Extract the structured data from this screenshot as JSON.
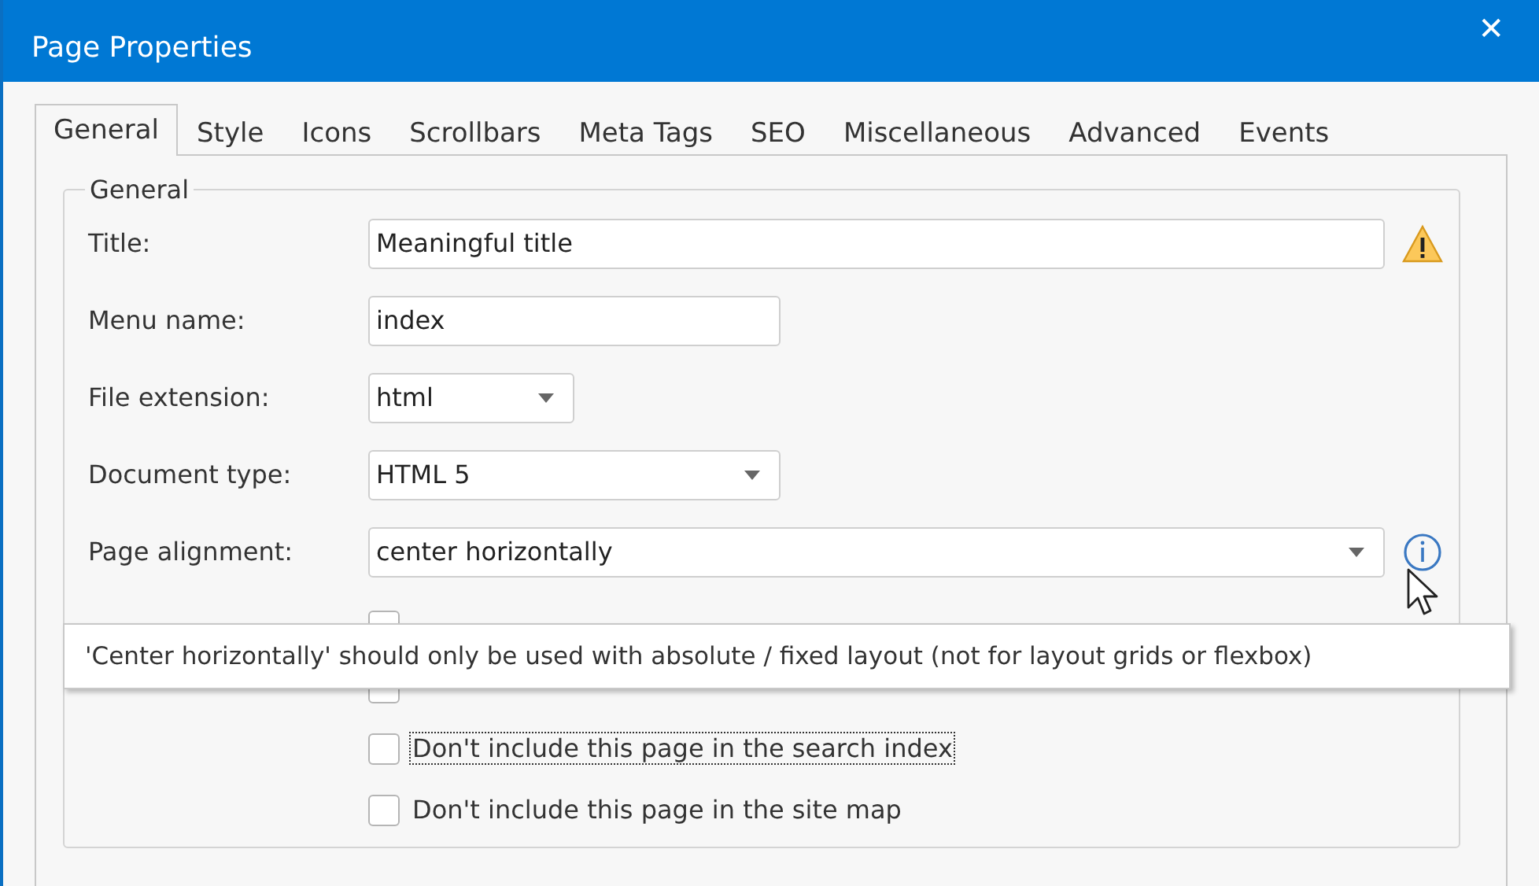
{
  "window": {
    "title": "Page Properties",
    "close": "✕"
  },
  "tabs": [
    {
      "label": "General",
      "selected": true
    },
    {
      "label": "Style",
      "selected": false
    },
    {
      "label": "Icons",
      "selected": false
    },
    {
      "label": "Scrollbars",
      "selected": false
    },
    {
      "label": "Meta Tags",
      "selected": false
    },
    {
      "label": "SEO",
      "selected": false
    },
    {
      "label": "Miscellaneous",
      "selected": false
    },
    {
      "label": "Advanced",
      "selected": false
    },
    {
      "label": "Events",
      "selected": false
    }
  ],
  "group": {
    "legend": "General"
  },
  "fields": [
    {
      "kind": "text",
      "label": "Title:",
      "value": "Meaningful title"
    },
    {
      "kind": "text",
      "label": "Menu name:",
      "value": "index"
    },
    {
      "kind": "select",
      "label": "File extension:",
      "value": "html"
    },
    {
      "kind": "select",
      "label": "Document type:",
      "value": "HTML 5"
    },
    {
      "kind": "select",
      "label": "Page alignment:",
      "value": "center horizontally"
    }
  ],
  "checkboxes": [
    {
      "checked": false
    },
    {
      "checked": false
    },
    {
      "label": "Don't include this page in the search index",
      "checked": false,
      "focused": true
    },
    {
      "label": "Don't include this page in the site map",
      "checked": false,
      "focused": false
    }
  ],
  "tooltip": {
    "text": "'Center horizontally' should only be used with absolute / fixed layout (not for layout grids or flexbox)"
  }
}
